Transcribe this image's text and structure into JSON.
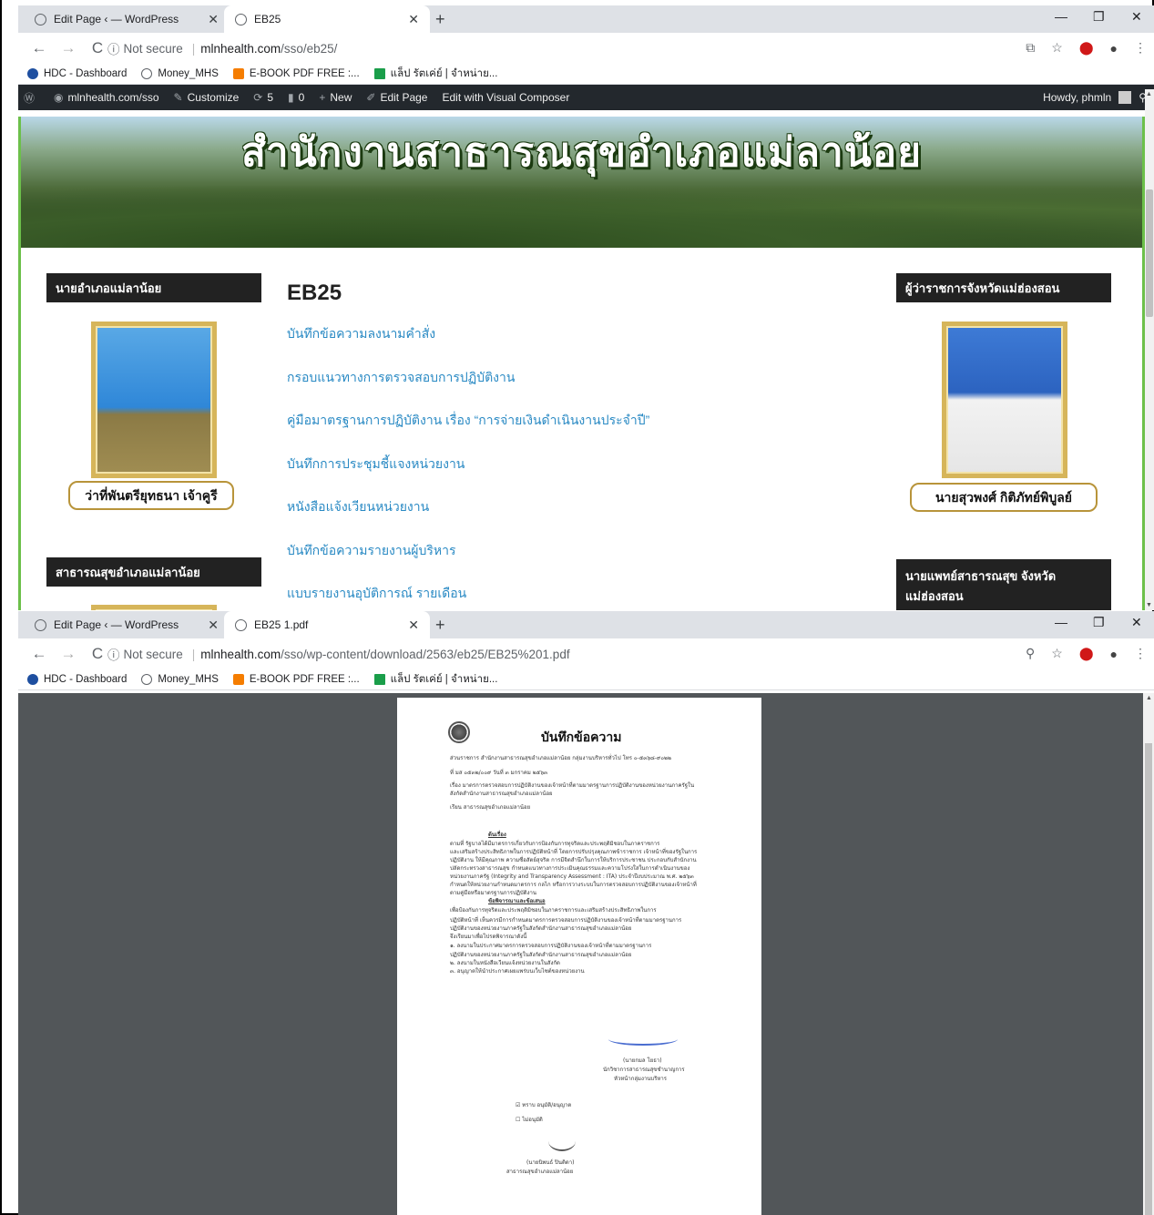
{
  "window1": {
    "tabs": [
      {
        "title": "Edit Page ‹ — WordPress",
        "active": false
      },
      {
        "title": "EB25",
        "active": true
      }
    ],
    "url": {
      "security": "Not secure",
      "host": "mlnhealth.com",
      "path": "/sso/eb25/"
    }
  },
  "window2": {
    "tabs": [
      {
        "title": "Edit Page ‹ — WordPress",
        "active": false
      },
      {
        "title": "EB25 1.pdf",
        "active": true
      }
    ],
    "url": {
      "security": "Not secure",
      "host": "mlnhealth.com",
      "path": "/sso/wp-content/download/2563/eb25/EB25%201.pdf"
    }
  },
  "bookmarks": [
    "HDC - Dashboard",
    "Money_MHS",
    "E-BOOK PDF FREE :...",
    "แล็ป รัตเค่ย์ | จำหน่าย..."
  ],
  "wp_admin_bar": {
    "site": "mlnhealth.com/sso",
    "customize": "Customize",
    "updates": "5",
    "comments": "0",
    "new": "New",
    "edit_page": "Edit Page",
    "visual_composer": "Edit with Visual Composer",
    "howdy": "Howdy, phmln"
  },
  "site": {
    "banner_title": "สำนักงานสาธารณสุขอำเภอแม่ลาน้อย",
    "left_widget_1": "นายอำเภอแม่ลาน้อย",
    "left_person": "ว่าที่พันตรียุทธนา เจ้าคูรี",
    "left_widget_2": "สาธารณสุขอำเภอแม่ลาน้อย",
    "right_widget_1": "ผู้ว่าราชการจังหวัดแม่ฮ่องสอน",
    "right_person": "นายสุวพงศ์ กิติภัทย์พิบูลย์",
    "right_widget_2": "นายแพทย์สาธารณสุข จังหวัดแม่ฮ่องสอน",
    "page_title": "EB25",
    "links": [
      "บันทึกข้อความลงนามคำสั่ง",
      "กรอบแนวทางการตรวจสอบการปฏิบัติงาน",
      "คู่มือมาตรฐานการปฏิบัติงาน เรื่อง “การจ่ายเงินดำเนินงานประจำปี”",
      "บันทึกการประชุมชี้แจงหน่วยงาน",
      "หนังสือแจ้งเวียนหน่วยงาน",
      "บันทึกข้อความรายงานผู้บริหาร",
      "แบบรายงานอุบัติการณ์ รายเดือน"
    ]
  },
  "pdf": {
    "heading": "บันทึกข้อความ",
    "lines": [
      "ส่วนราชการ  สำนักงานสาธารณสุขอำเภอแม่ลาน้อย กลุ่มงานบริหารทั่วไป โทร ๐-๕๓๖๘-๙๐๒๒",
      "ที่  มส ๐๕๓๒/๐๐๙                                         วันที่  ๓ มกราคม ๒๕๖๓",
      "เรื่อง  มาตรการตรวจสอบการปฏิบัติงานของเจ้าหน้าที่ตามมาตรฐานการปฏิบัติงานของหน่วยงานภาครัฐใน",
      "         สังกัดสำนักงานสาธารณสุขอำเภอแม่ลาน้อย",
      "เรียน  สาธารณสุขอำเภอแม่ลาน้อย",
      "",
      "ต้นเรื่อง",
      "      ตามที่ รัฐบาลได้มีมาตรการเกี่ยวกับการป้องกันการทุจริตและประพฤติมิชอบในภาคราชการ",
      "และเสริมสร้างประสิทธิภาพในการปฏิบัติหน้าที่ โดยการปรับปรุงคุณภาพข้าราชการ เจ้าหน้าที่ของรัฐในการ",
      "ปฏิบัติงาน ให้มีคุณภาพ ความซื่อสัตย์สุจริต การมีจิตสำนึกในการให้บริการประชาชน ประกอบกับสำนักงาน",
      "ปลัดกระทรวงสาธารณสุข กำหนดแนวทางการประเมินคุณธรรมและความโปร่งใสในการดำเนินงานของ",
      "หน่วยงานภาครัฐ (Integrity and Transparency Assessment : ITA) ประจำปีงบประมาณ พ.ศ. ๒๕๖๓",
      "กำหนดให้หน่วยงานกำหนดมาตรการ กลไก หรือการวางระบบในการตรวจสอบการปฏิบัติงานของเจ้าหน้าที่",
      "ตามคู่มือหรือมาตรฐานการปฏิบัติงาน",
      "ข้อพิจารณาและข้อเสนอ",
      "      เพื่อป้องกันการทุจริตและประพฤติมิชอบในภาคราชการและเสริมสร้างประสิทธิภาพในการ",
      "ปฏิบัติหน้าที่ เห็นควรมีการกำหนดมาตรการตรวจสอบการปฏิบัติงานของเจ้าหน้าที่ตามมาตรฐานการ",
      "ปฏิบัติงานของหน่วยงานภาครัฐในสังกัดสำนักงานสาธารณสุขอำเภอแม่ลาน้อย",
      "      จึงเรียนมาเพื่อโปรดพิจารณาดังนี้",
      "         ๑. ลงนามในประกาศมาตรการตรวจสอบการปฏิบัติงานของเจ้าหน้าที่ตามมาตรฐานการ",
      "            ปฏิบัติงานของหน่วยงานภาครัฐในสังกัดสำนักงานสาธารณสุขอำเภอแม่ลาน้อย",
      "         ๒. ลงนามในหนังสือเวียนแจ้งหน่วยงานในสังกัด",
      "         ๓. อนุญาตให้นำประกาศเผยแพร่บนเว็บไซต์ของหน่วยงาน"
    ],
    "signer": [
      "(นายกมล โยธา)",
      "นักวิชาการสาธารณสุขชำนาญการ",
      "หัวหน้ากลุ่มงานบริหาร"
    ],
    "approve_options": [
      "☑  ทราบ  อนุมัติ/อนุญาต",
      "☐  ไม่อนุมัติ"
    ],
    "approver": [
      "(นายนิพนธ์  ปินติดา)",
      "สาธารณสุขอำเภอแม่ลาน้อย"
    ]
  },
  "colors": {
    "accent_green": "#6cc04a",
    "link": "#2a8ac4",
    "wp_bar": "#23282d",
    "pdf_bg": "#525659"
  }
}
